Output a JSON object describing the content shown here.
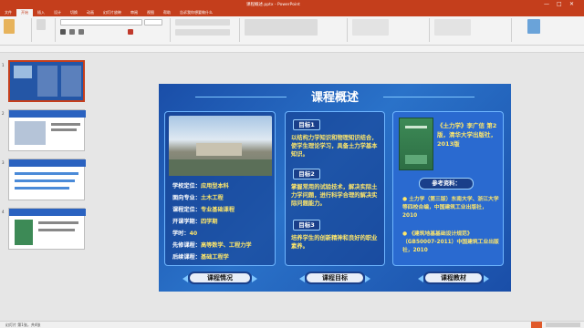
{
  "window": {
    "title": "课程概述.pptx - PowerPoint"
  },
  "ribbon_tabs": [
    "文件",
    "开始",
    "插入",
    "设计",
    "切换",
    "动画",
    "幻灯片放映",
    "审阅",
    "视图",
    "帮助",
    "告诉我你想要做什么"
  ],
  "active_tab": "开始",
  "thumbnails": [
    {
      "num": "1"
    },
    {
      "num": "2"
    },
    {
      "num": "3"
    },
    {
      "num": "4"
    }
  ],
  "slide": {
    "title": "课程概述",
    "info": [
      {
        "key": "学校定位：",
        "value": "应用型本科"
      },
      {
        "key": "面向专业：",
        "value": "土木工程"
      },
      {
        "key": "课程定位：",
        "value": "专业基础课程"
      },
      {
        "key": "开课学期：",
        "value": "四学期"
      },
      {
        "key": "学时：",
        "value": "40"
      },
      {
        "key": "先修课程：",
        "value": "高等数学、工程力学"
      },
      {
        "key": "后续课程：",
        "value": "基础工程学"
      }
    ],
    "goals": [
      {
        "tag": "目标1",
        "text": "以结构力学知识和物理知识结合，使学生理论学习，具备土力学基本知识。"
      },
      {
        "tag": "目标2",
        "text": "掌握常用的试验技术，解决实际土力学问题，进行科学合理的解决实际问题能力。"
      },
      {
        "tag": "目标3",
        "text": "培养学生的创新精神和良好的职业素养。"
      }
    ],
    "book": "《土力学》李广信 第2版，清华大学出版社，2013版",
    "ref_tag": "参考资料：",
    "refs": [
      "● 土力学（第三版）东南大学、浙江大学等四校合编，中国建筑工业出版社，2010",
      "● 《建筑地基基础设计规范》（GB50007-2011）中国建筑工业出版社，2010"
    ],
    "buttons": [
      "课程情况",
      "课程目标",
      "课程教材"
    ]
  },
  "status": {
    "left": "幻灯片 第1张，共4张",
    "right": ""
  },
  "colors": {
    "accent": "#c43e1c",
    "slide_bg": "#2a72c9",
    "highlight_text": "#ffe76a"
  }
}
